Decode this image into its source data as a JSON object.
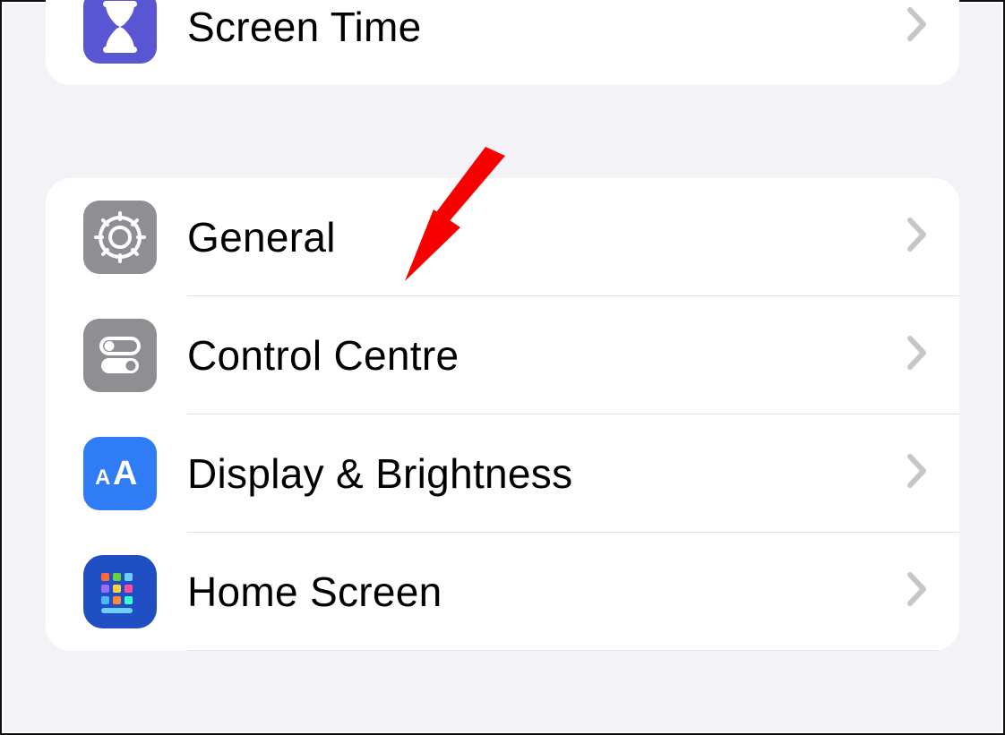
{
  "list": {
    "group1": {
      "items": [
        {
          "label": "Screen Time",
          "icon": "hourglass-icon",
          "bg": "bg-purple"
        }
      ]
    },
    "group2": {
      "items": [
        {
          "label": "General",
          "icon": "gear-icon",
          "bg": "bg-grey"
        },
        {
          "label": "Control Centre",
          "icon": "toggles-icon",
          "bg": "bg-grey"
        },
        {
          "label": "Display & Brightness",
          "icon": "aa-icon",
          "bg": "bg-blue"
        },
        {
          "label": "Home Screen",
          "icon": "app-grid-icon",
          "bg": "bg-navy"
        }
      ]
    }
  },
  "annotation": {
    "target": "row-general",
    "color": "#ff0000"
  }
}
